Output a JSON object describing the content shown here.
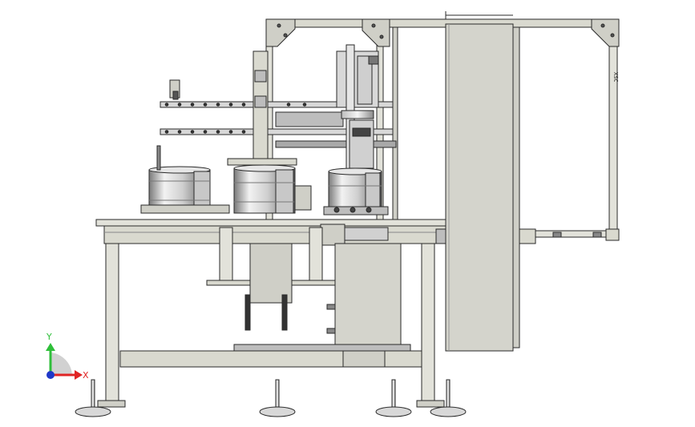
{
  "triad": {
    "y_label": "Y",
    "x_label": "X",
    "y_color": "#2fbf3a",
    "x_color": "#e02424",
    "origin_color": "#2038c8"
  },
  "palette": {
    "frame": "#d9d9cf",
    "frame_stroke": "#2a2a2a",
    "metal": "#d8d8d8",
    "panel": "#d4d4cc",
    "dark": "#2c2c2c",
    "shade": "#a9a9a9"
  },
  "column_mark": "XSC"
}
